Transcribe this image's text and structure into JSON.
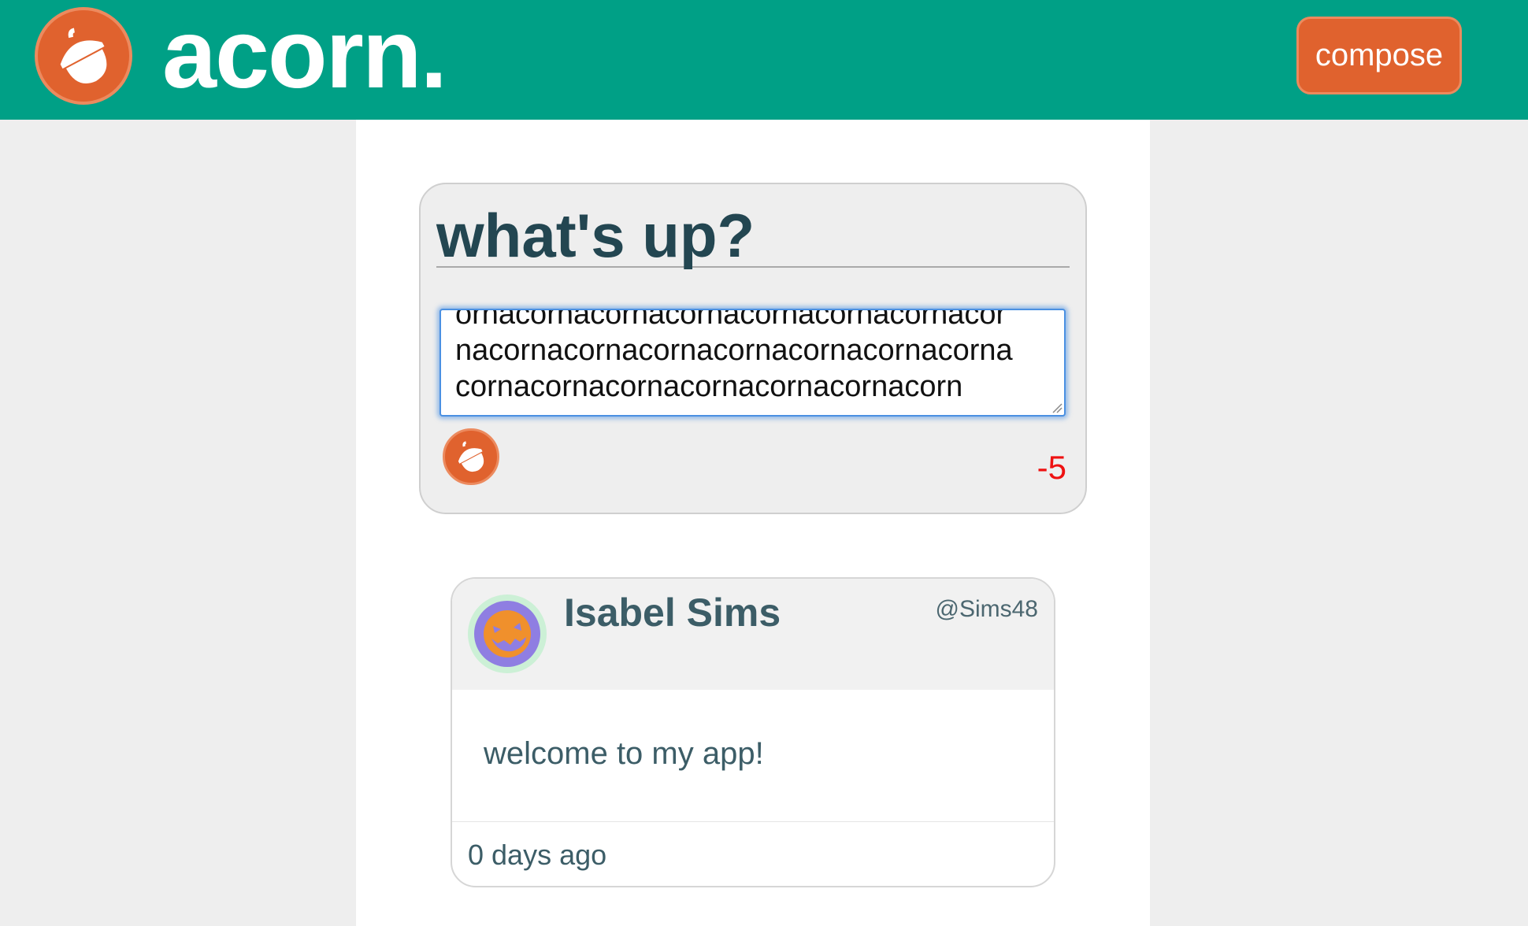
{
  "header": {
    "brand": "acorn.",
    "compose_label": "compose",
    "logo_icon": "acorn-icon"
  },
  "composer": {
    "title": "what's up?",
    "text_lines": [
      "ornacornacornacornacornacornacornacor",
      "nacornacornacornacornacornacornacorna",
      "cornacornacornacornacornacornacorn"
    ],
    "char_count": "-5",
    "char_count_color": "#ee1111"
  },
  "post": {
    "name": "Isabel Sims",
    "handle": "@Sims48",
    "body": "welcome to my app!",
    "time": "0 days ago",
    "avatar_icon": "pumpkin-avatar-icon"
  },
  "colors": {
    "brand_green": "#00a086",
    "accent_orange": "#e0622e",
    "text_dark": "#234651"
  }
}
